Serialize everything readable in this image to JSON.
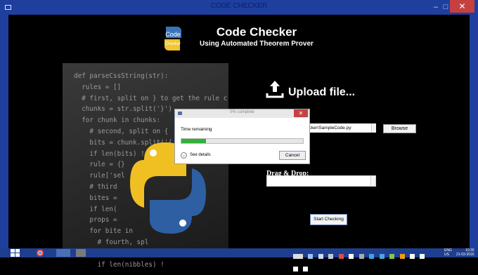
{
  "window": {
    "title": "CODE CHECKER",
    "close_glyph": "✕",
    "minimize_glyph": "–",
    "maximize_glyph": "□"
  },
  "header": {
    "title": "Code Checker",
    "subtitle": "Using Automated Theorem Prover",
    "logo_text_top": "Code",
    "logo_text_bottom": "Checker"
  },
  "code_lines": [
    "def parseCssString(str):",
    "  rules = []",
    "  # first, split on } to get the rule c",
    "  chunks = str.split('}')",
    "  for chunk in chunks:",
    "    # second, split on {",
    "    bits = chunk.split('{",
    "    if len(bits) !",
    "    rule = {}",
    "    rule['sel",
    "    # third",
    "    bites =",
    "    if len(",
    "    props =",
    "    for bite in",
    "      # fourth, spl",
    "      nibbles = bite.strip",
    "      if len(nibbles) !"
  ],
  "upload": {
    "label": "Upload file...",
    "icon": "upload-icon"
  },
  "form": {
    "path_value": "hecker\\SampleCode.py",
    "browse_label": "Browse",
    "drag_drop_label": "Drag & Drop:",
    "drag_drop_value": "",
    "start_label": "Start Checking"
  },
  "dialog": {
    "title": "0% complete",
    "time_remaining": "Time remaining",
    "progress": 0.2,
    "see_details": "See details",
    "cancel_label": "Cancel"
  },
  "taskbar": {
    "language": "ENG",
    "language_sub": "US",
    "time": "10:30",
    "date": "21-03-2016"
  },
  "colors": {
    "titlebar": "#1f3f9e",
    "progress": "#2fb236",
    "close": "#c74040"
  }
}
